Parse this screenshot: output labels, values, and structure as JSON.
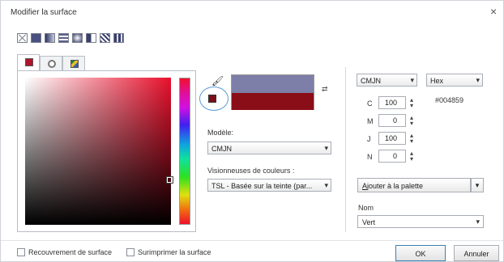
{
  "window": {
    "title": "Modifier la surface",
    "close_glyph": "×"
  },
  "fill_types": [
    {
      "name": "none-fill-icon"
    },
    {
      "name": "uniform-fill-icon"
    },
    {
      "name": "fountain-fill-icon"
    },
    {
      "name": "vector-pattern-icon"
    },
    {
      "name": "bitmap-pattern-icon"
    },
    {
      "name": "two-color-pattern-icon"
    },
    {
      "name": "texture-fill-icon"
    },
    {
      "name": "postscript-fill-icon"
    }
  ],
  "picker_tabs": [
    "color-model-tab",
    "color-harmony-tab",
    "color-palette-tab"
  ],
  "preview": {
    "new_color": "#7e7fa8",
    "old_color": "#8a0e18",
    "swap_glyph": "⇄"
  },
  "model": {
    "label": "Modèle:",
    "value": "CMJN"
  },
  "viewers": {
    "label": "Visionneuses de couleurs :",
    "value": "TSL - Basée sur la teinte (par..."
  },
  "right": {
    "mode_select": "CMJN",
    "format_select": "Hex",
    "hex": "#004859",
    "channels": [
      {
        "label": "C",
        "value": "100"
      },
      {
        "label": "M",
        "value": "0"
      },
      {
        "label": "J",
        "value": "100"
      },
      {
        "label": "N",
        "value": "0"
      }
    ],
    "add_button_prefix": "A",
    "add_button_rest": "jouter à la palette",
    "name_label": "Nom",
    "name_value": "Vert"
  },
  "footer": {
    "overlay_label": "Recouvrement de surface",
    "overprint_label": "Surimprimer la surface",
    "ok_label": "OK",
    "cancel_label": "Annuler"
  }
}
